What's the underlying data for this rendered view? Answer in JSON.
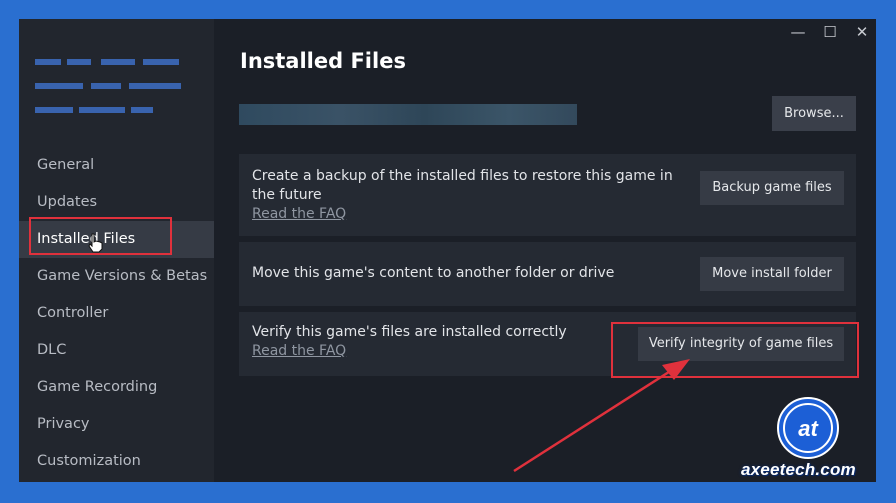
{
  "window": {
    "controls": [
      "—",
      "☐",
      "✕"
    ]
  },
  "sidebar": {
    "items": [
      {
        "label": "General"
      },
      {
        "label": "Updates"
      },
      {
        "label": "Installed Files",
        "active": true
      },
      {
        "label": "Game Versions & Betas"
      },
      {
        "label": "Controller"
      },
      {
        "label": "DLC"
      },
      {
        "label": "Game Recording"
      },
      {
        "label": "Privacy"
      },
      {
        "label": "Customization"
      }
    ]
  },
  "main": {
    "title": "Installed Files",
    "browse_label": "Browse...",
    "rows": [
      {
        "text": "Create a backup of the installed files to restore this game in the future",
        "link": "Read the FAQ",
        "button": "Backup game files"
      },
      {
        "text": "Move this game's content to another folder or drive",
        "button": "Move install folder"
      },
      {
        "text": "Verify this game's files are installed correctly",
        "link": "Read the FAQ",
        "button": "Verify integrity of game files"
      }
    ]
  },
  "watermark": {
    "brand": "axeetech.com",
    "logo_text": "at"
  },
  "colors": {
    "highlight": "#e0313c",
    "background": "#2a6fd0"
  }
}
